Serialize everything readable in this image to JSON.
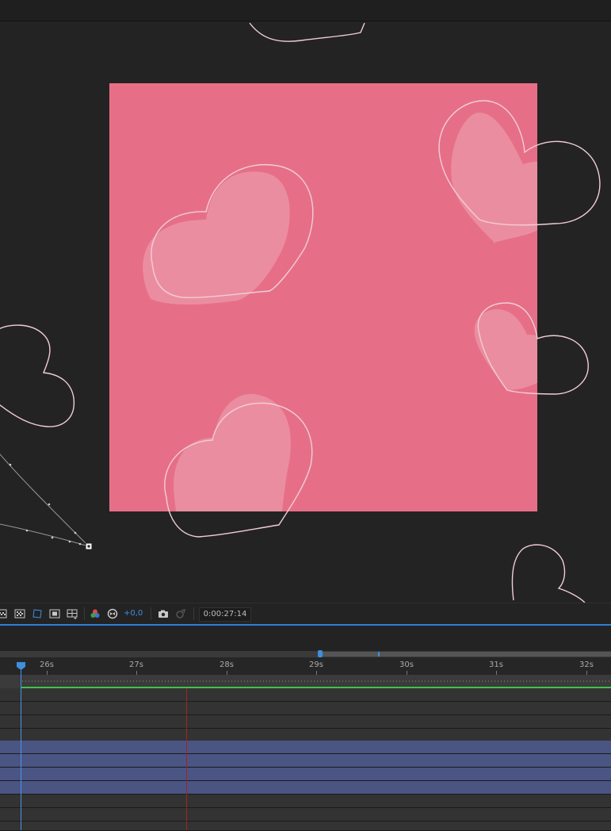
{
  "viewer": {
    "comp_color": "#e66f87",
    "heart_fill": "#eb8fa2",
    "outline_color": "#f2cdd6",
    "background_color": "#232323"
  },
  "toolbar": {
    "icons": [
      "transparency-grid-icon",
      "region-of-interest-icon",
      "mask-path-icon",
      "safe-zones-icon",
      "grid-guides-icon",
      "color-channels-icon",
      "reset-exposure-icon",
      "camera-snapshot-icon",
      "show-snapshot-icon"
    ],
    "exposure_value": "+0,0",
    "current_time": "0:00:27:14"
  },
  "timeline": {
    "ruler_labels": [
      "26s",
      "27s",
      "28s",
      "29s",
      "30s",
      "31s",
      "32s"
    ],
    "track_colors": {
      "gray": "#333333",
      "blue": "#4a5584"
    },
    "work_area_color": "#3ec24a",
    "playhead_color": "#3d8fe0"
  }
}
